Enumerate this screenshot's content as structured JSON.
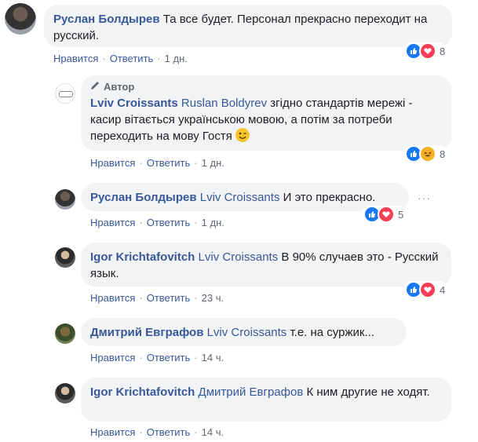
{
  "comments": [
    {
      "author": "Руслан Болдырев",
      "text": " Та все будет. Персонал прекрасно переходит на русский.",
      "time": "1 дн.",
      "reactions": {
        "count": "8",
        "icons": [
          "like-icon",
          "love-icon"
        ]
      }
    },
    {
      "badge": "Автор",
      "author": "Lviv Croissants",
      "mention": "Ruslan Boldyrev",
      "text": " згідно стандартів мережі - касир вітається українською мовою, а потім за потреби переходить на мову Гостя ",
      "emoji": "😉",
      "time": "1 дн.",
      "reactions": {
        "count": "8",
        "icons": [
          "like-icon",
          "haha-icon"
        ]
      }
    },
    {
      "author": "Руслан Болдырев",
      "mention": "Lviv Croissants",
      "text": " И это прекрасно.",
      "time": "1 дн.",
      "reactions": {
        "count": "5",
        "icons": [
          "like-icon",
          "love-icon"
        ]
      }
    },
    {
      "author": "Igor Krichtafovitch",
      "mention": "Lviv Croissants",
      "text": " В 90% случаев это - Русский язык.",
      "time": "23 ч.",
      "reactions": {
        "count": "4",
        "icons": [
          "like-icon",
          "love-icon"
        ]
      }
    },
    {
      "author": "Дмитрий Евграфов",
      "mention": "Lviv Croissants",
      "text": " т.е. на суржик...",
      "time": "14 ч."
    },
    {
      "author": "Igor Krichtafovitch",
      "mention": "Дмитрий Евграфов",
      "text": " К ним другие не ходят.",
      "time": "14 ч."
    }
  ],
  "actions": {
    "like": "Нравится",
    "reply": "Ответить",
    "dot": "·"
  },
  "more": "···",
  "colors": {
    "link": "#385898",
    "bubble": "#f2f3f5",
    "like": "#1877f2",
    "love": "#f33e58"
  }
}
